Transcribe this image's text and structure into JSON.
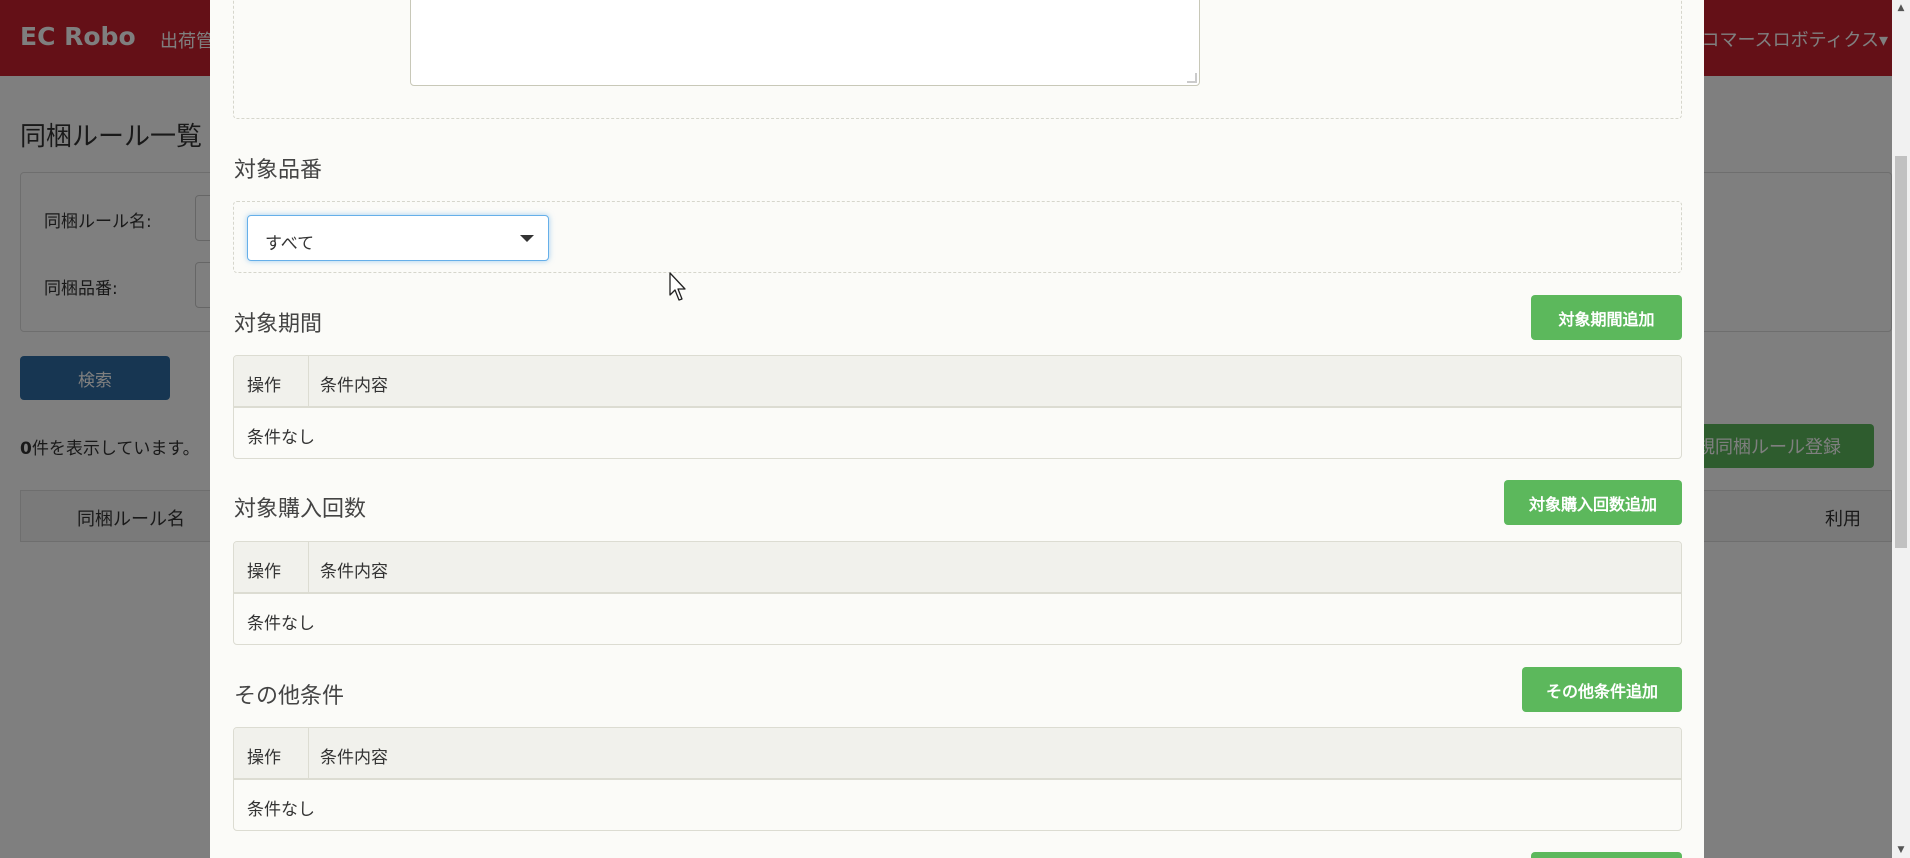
{
  "navbar": {
    "brand": "EC Robo",
    "menu_item": "出荷管",
    "user_menu": "コマースロボティクス▾"
  },
  "background": {
    "page_title": "同梱ルール一覧",
    "search": {
      "rule_name_label": "同梱ルール名:",
      "product_code_label": "同梱品番:"
    },
    "search_button": "検索",
    "result_count_prefix": "0",
    "result_count_suffix": "件を表示しています。",
    "new_rule_button": "新規同梱ルール登録",
    "table_headers": [
      "同梱ルール名",
      "利用"
    ]
  },
  "modal": {
    "target_product": {
      "title": "対象品番",
      "select_value": "すべて"
    },
    "target_period": {
      "title": "対象期間",
      "add_button": "対象期間追加",
      "col_operation": "操作",
      "col_content": "条件内容",
      "empty_text": "条件なし"
    },
    "target_purchase_count": {
      "title": "対象購入回数",
      "add_button": "対象購入回数追加",
      "col_operation": "操作",
      "col_content": "条件内容",
      "empty_text": "条件なし"
    },
    "other_conditions": {
      "title": "その他条件",
      "add_button": "その他条件追加",
      "col_operation": "操作",
      "col_content": "条件内容",
      "empty_text": "条件なし"
    }
  },
  "colors": {
    "navbar": "#c9202f",
    "primary_button": "#2e6da4",
    "success_button": "#5cb85c",
    "modal_background": "#fbfbf8"
  }
}
